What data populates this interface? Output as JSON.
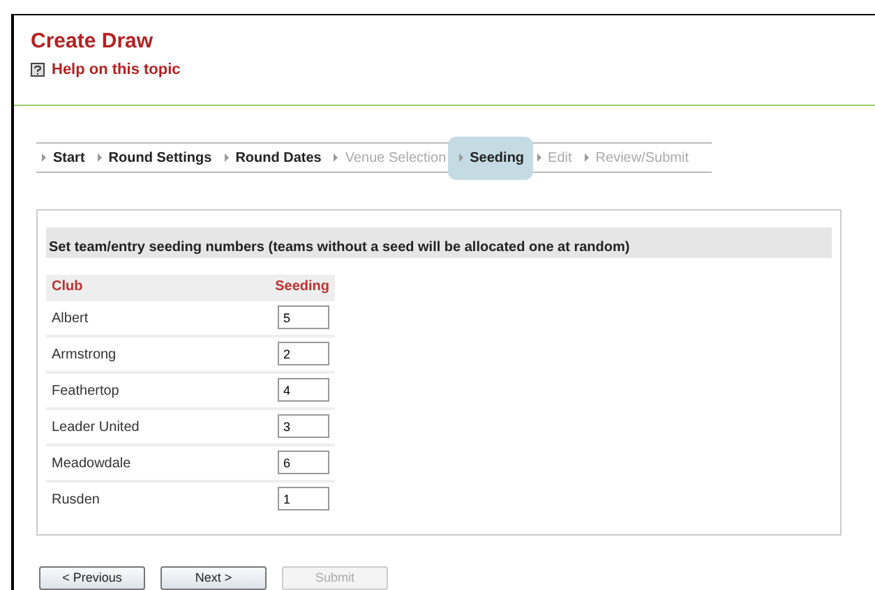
{
  "title": "Create Draw",
  "help_link": "Help on this topic",
  "steps": [
    {
      "label": "Start",
      "selected": false,
      "disabled": false
    },
    {
      "label": "Round Settings",
      "selected": false,
      "disabled": false
    },
    {
      "label": "Round Dates",
      "selected": false,
      "disabled": false
    },
    {
      "label": "Venue Selection",
      "selected": false,
      "disabled": true
    },
    {
      "label": "Seeding",
      "selected": true,
      "disabled": false
    },
    {
      "label": "Edit",
      "selected": false,
      "disabled": true
    },
    {
      "label": "Review/Submit",
      "selected": false,
      "disabled": true
    }
  ],
  "instructions": "Set team/entry seeding numbers (teams without a seed will be allocated one at random)",
  "table": {
    "columns": [
      "Club",
      "Seeding"
    ],
    "rows": [
      {
        "club": "Albert",
        "seeding": "5"
      },
      {
        "club": "Armstrong",
        "seeding": "2"
      },
      {
        "club": "Feathertop",
        "seeding": "4"
      },
      {
        "club": "Leader United",
        "seeding": "3"
      },
      {
        "club": "Meadowdale",
        "seeding": "6"
      },
      {
        "club": "Rusden",
        "seeding": "1"
      }
    ]
  },
  "buttons": [
    {
      "label": "< Previous",
      "disabled": false
    },
    {
      "label": "Next >",
      "disabled": false
    },
    {
      "label": "Submit",
      "disabled": true
    }
  ]
}
